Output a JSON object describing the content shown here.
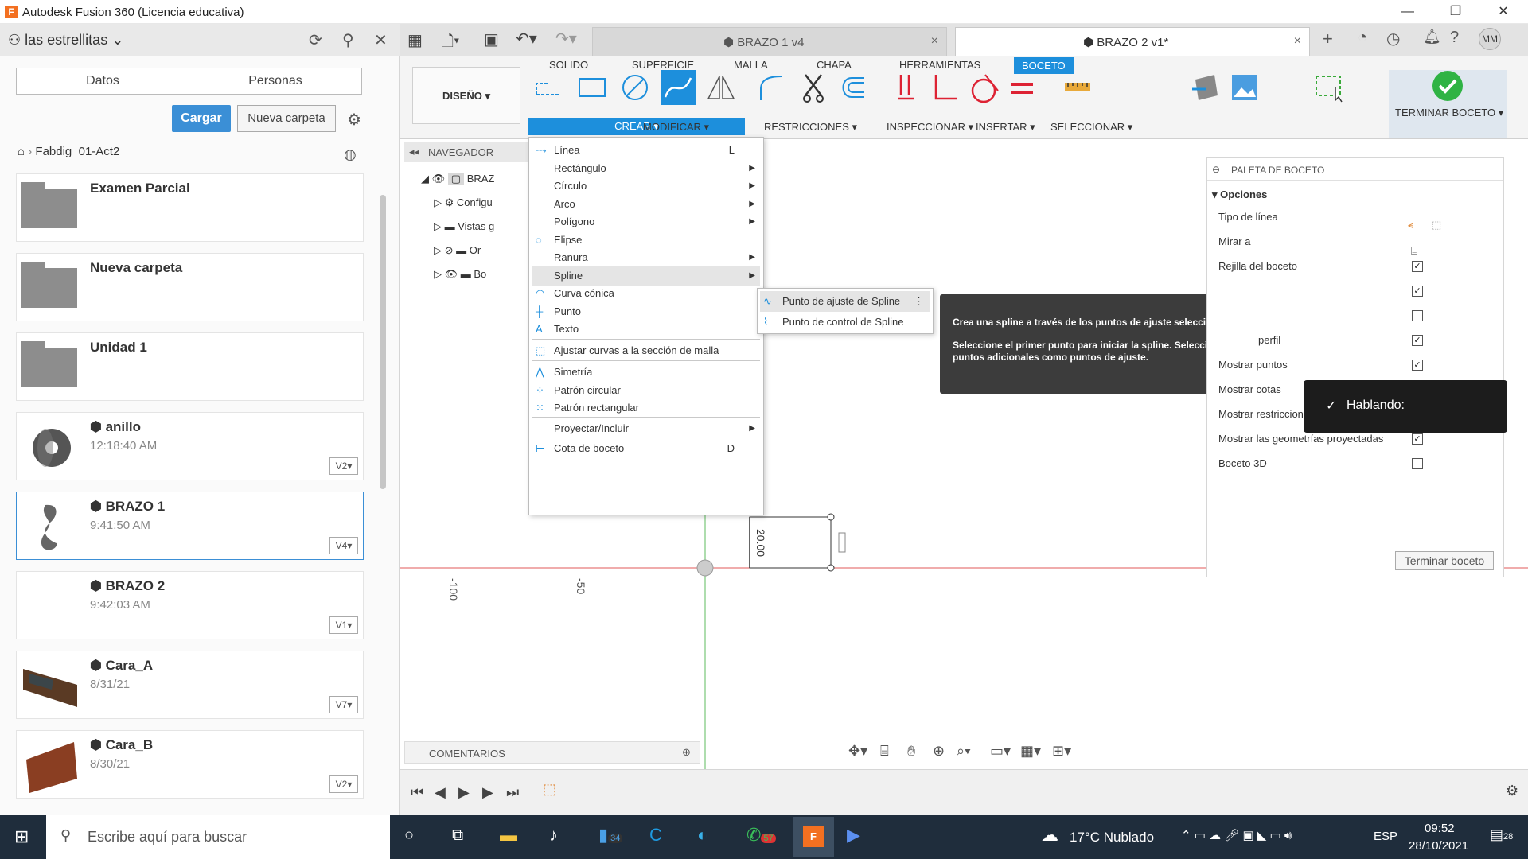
{
  "window": {
    "title": "Autodesk Fusion 360 (Licencia educativa)",
    "app_icon": "F"
  },
  "left_panel": {
    "team": "las estrellitas",
    "tabs": [
      "Datos",
      "Personas"
    ],
    "upload_label": "Cargar",
    "new_folder_label": "Nueva carpeta",
    "breadcrumb": "Fabdig_01-Act2",
    "folders": [
      {
        "name": "Examen Parcial"
      },
      {
        "name": "Nueva carpeta"
      },
      {
        "name": "Unidad 1"
      }
    ],
    "files": [
      {
        "name": "anillo",
        "time": "12:18:40 AM",
        "version": "V2"
      },
      {
        "name": "BRAZO 1",
        "time": "9:41:50 AM",
        "version": "V4"
      },
      {
        "name": "BRAZO 2",
        "time": "9:42:03 AM",
        "version": "V1"
      },
      {
        "name": "Cara_A",
        "time": "8/31/21",
        "version": "V7"
      },
      {
        "name": "Cara_B",
        "time": "8/30/21",
        "version": "V2"
      }
    ]
  },
  "tabs": [
    {
      "label": "BRAZO 1 v4",
      "close": "×"
    },
    {
      "label": "BRAZO 2 v1*",
      "close": "×"
    }
  ],
  "tabbar_icons": [
    "plus-icon",
    "online-icon",
    "clock-icon",
    "bell-icon",
    "help-icon"
  ],
  "user_initials": "MM",
  "ribbon": {
    "tabs": [
      "SOLIDO",
      "SUPERFICIE",
      "MALLA",
      "CHAPA",
      "HERRAMIENTAS",
      "BOCETO"
    ],
    "workspace": "DISEÑO ▾",
    "groups": {
      "crear": "CREAR ▾",
      "modificar": "MODIFICAR ▾",
      "restricciones": "RESTRICCIONES ▾",
      "inspeccionar": "INSPECCIONAR ▾",
      "insertar": "INSERTAR ▾",
      "seleccionar": "SELECCIONAR ▾",
      "terminar": "TERMINAR BOCETO ▾"
    }
  },
  "navigator": {
    "title": "NAVEGADOR",
    "rows": [
      "BRAZ",
      "Configu",
      "Vistas g",
      "Or",
      "Bo"
    ]
  },
  "menu": {
    "items": [
      {
        "label": "Línea",
        "key": "L",
        "arrow": ""
      },
      {
        "label": "Rectángulo",
        "key": "",
        "arrow": "▶"
      },
      {
        "label": "Círculo",
        "key": "",
        "arrow": "▶"
      },
      {
        "label": "Arco",
        "key": "",
        "arrow": "▶"
      },
      {
        "label": "Polígono",
        "key": "",
        "arrow": "▶"
      },
      {
        "label": "Elipse",
        "key": "",
        "arrow": ""
      },
      {
        "label": "Ranura",
        "key": "",
        "arrow": "▶"
      },
      {
        "label": "Spline",
        "key": "",
        "arrow": "▶"
      },
      {
        "label": "Curva cónica",
        "key": "",
        "arrow": ""
      },
      {
        "label": "Punto",
        "key": "",
        "arrow": ""
      },
      {
        "label": "Texto",
        "key": "",
        "arrow": ""
      },
      {
        "label": "Ajustar curvas a la sección de malla",
        "key": "",
        "arrow": ""
      },
      {
        "label": "Simetría",
        "key": "",
        "arrow": ""
      },
      {
        "label": "Patrón circular",
        "key": "",
        "arrow": ""
      },
      {
        "label": "Patrón rectangular",
        "key": "",
        "arrow": ""
      },
      {
        "label": "Proyectar/Incluir",
        "key": "",
        "arrow": "▶"
      },
      {
        "label": "Cota de boceto",
        "key": "D",
        "arrow": ""
      }
    ],
    "submenu": [
      "Punto de ajuste de Spline",
      "Punto de control de Spline"
    ]
  },
  "tooltip": {
    "line1": "Crea una spline a través de los puntos de ajuste seleccionados.",
    "line2": "Seleccione el primer punto para iniciar la spline. Seleccione puntos adicionales como puntos de ajuste."
  },
  "canvas": {
    "dimension": "20.00",
    "axis_labels": [
      "-100",
      "-50"
    ]
  },
  "palette": {
    "title": "PALETA DE BOCETO",
    "section": "Opciones",
    "rows": [
      {
        "label": "Tipo de línea",
        "checked": null
      },
      {
        "label": "Mirar a",
        "checked": null
      },
      {
        "label": "Rejilla del boceto",
        "checked": true
      },
      {
        "label": "",
        "checked": true
      },
      {
        "label": "",
        "checked": false
      },
      {
        "label": "perfil",
        "checked": true
      },
      {
        "label": "Mostrar puntos",
        "checked": true
      },
      {
        "label": "Mostrar cotas",
        "checked": true
      },
      {
        "label": "Mostrar restricciones",
        "checked": true
      },
      {
        "label": "Mostrar las geometrías proyectadas",
        "checked": true
      },
      {
        "label": "Boceto 3D",
        "checked": false
      }
    ],
    "finish_label": "Terminar boceto",
    "check_mark": "✓"
  },
  "speaking": {
    "label": "Hablando:"
  },
  "comments": {
    "label": "COMENTARIOS"
  },
  "taskbar": {
    "search_placeholder": "Escribe aquí para buscar",
    "badges": {
      "files": "34",
      "whatsapp": "57"
    },
    "weather": "17°C  Nublado",
    "lang": "ESP",
    "time": "09:52",
    "date": "28/10/2021",
    "notifications": "28"
  },
  "colors": {
    "accent": "#1d8fdc",
    "finish_green": "#2fb344",
    "x_axis": "#e05a5a",
    "y_axis": "#5dbb5d"
  }
}
